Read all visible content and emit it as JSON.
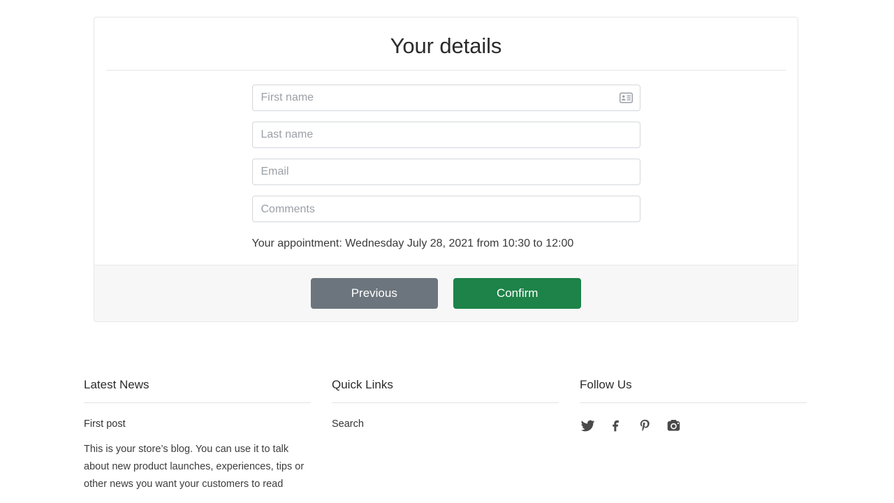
{
  "card": {
    "title": "Your details",
    "fields": [
      {
        "name": "first-name",
        "placeholder": "First name",
        "value": "",
        "type": "text",
        "icon": "contact-card-autofill-icon"
      },
      {
        "name": "last-name",
        "placeholder": "Last name",
        "value": "",
        "type": "text"
      },
      {
        "name": "email",
        "placeholder": "Email",
        "value": "",
        "type": "text"
      },
      {
        "name": "comments",
        "placeholder": "Comments",
        "value": "",
        "type": "textarea"
      }
    ],
    "appointment_text": "Your appointment: Wednesday July 28, 2021 from 10:30 to 12:00",
    "buttons": {
      "previous": "Previous",
      "confirm": "Confirm"
    },
    "colors": {
      "previous_bg": "#6c757d",
      "confirm_bg": "#1d8348",
      "card_border": "#e7e7e7",
      "footer_bg": "#f7f7f7",
      "input_border": "#d3d7db",
      "placeholder": "#9aa0a6"
    }
  },
  "footer": {
    "columns": [
      {
        "heading": "Latest News",
        "post_title": "First post",
        "post_body": "This is your store’s blog. You can use it to talk about new product launches, experiences, tips or other news you want your customers to read"
      },
      {
        "heading": "Quick Links",
        "links": [
          {
            "label": "Search"
          }
        ]
      },
      {
        "heading": "Follow Us",
        "social": [
          {
            "name": "twitter-icon",
            "label": "Twitter"
          },
          {
            "name": "facebook-icon",
            "label": "Facebook"
          },
          {
            "name": "pinterest-icon",
            "label": "Pinterest"
          },
          {
            "name": "instagram-icon",
            "label": "Instagram"
          }
        ]
      }
    ]
  }
}
